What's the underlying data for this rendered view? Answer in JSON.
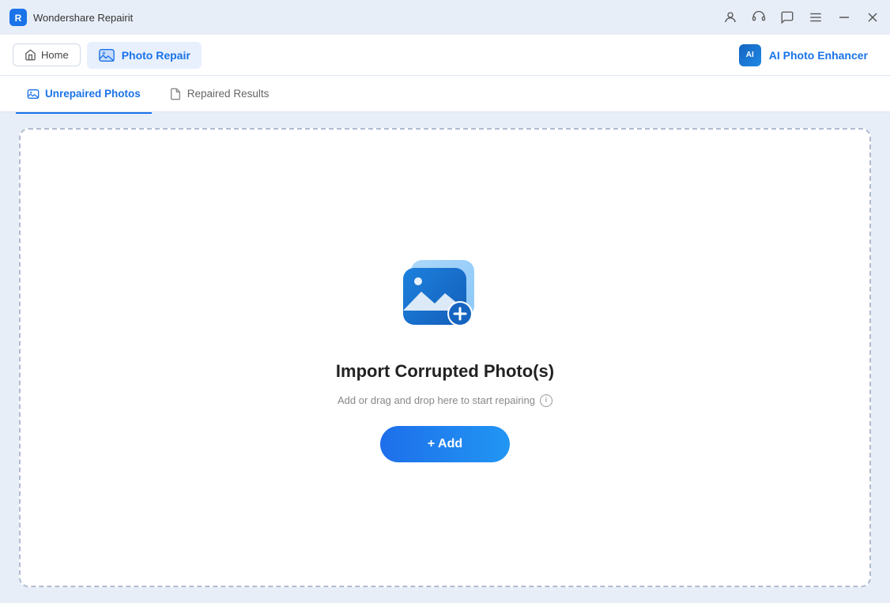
{
  "app": {
    "name": "Wondershare Repairit",
    "icon": "app-icon"
  },
  "titlebar": {
    "icons": [
      "account-icon",
      "headset-icon",
      "chat-icon",
      "menu-icon"
    ],
    "controls": [
      "minimize-icon",
      "close-icon"
    ]
  },
  "navbar": {
    "home_label": "Home",
    "photo_repair_label": "Photo Repair",
    "ai_enhancer_label": "AI Photo Enhancer",
    "ai_badge": "AI"
  },
  "tabs": {
    "unrepaired": "Unrepaired Photos",
    "repaired": "Repaired Results"
  },
  "dropzone": {
    "title": "Import Corrupted Photo(s)",
    "subtitle": "Add or drag and drop here to start repairing",
    "add_button": "+ Add"
  },
  "colors": {
    "primary": "#1a73e8",
    "primary_gradient_start": "#1e6fea",
    "primary_gradient_end": "#2196f3",
    "background": "#e8eef8",
    "white": "#ffffff",
    "border": "#b0bcd0",
    "text_dark": "#222222",
    "text_light": "#888888"
  }
}
